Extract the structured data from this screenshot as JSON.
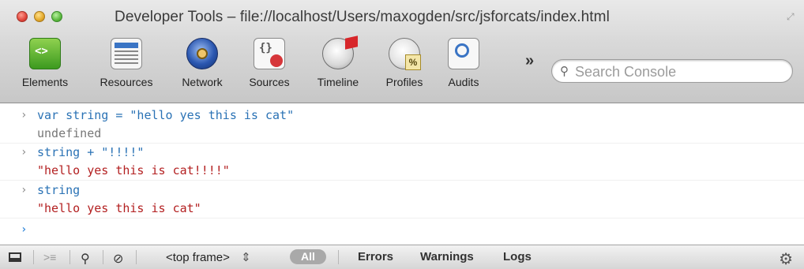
{
  "window": {
    "title": "Developer Tools – file://localhost/Users/maxogden/src/jsforcats/index.html"
  },
  "toolbar": {
    "tools": [
      {
        "label": "Elements",
        "icon": "elements-icon"
      },
      {
        "label": "Resources",
        "icon": "resources-icon"
      },
      {
        "label": "Network",
        "icon": "network-icon"
      },
      {
        "label": "Sources",
        "icon": "sources-icon"
      },
      {
        "label": "Timeline",
        "icon": "timeline-icon"
      },
      {
        "label": "Profiles",
        "icon": "profiles-icon"
      },
      {
        "label": "Audits",
        "icon": "audits-icon"
      }
    ],
    "more_label": "»",
    "search_placeholder": "Search Console"
  },
  "console": {
    "entries": [
      {
        "prompt": "›",
        "command": "var string = \"hello yes this is cat\"",
        "result": "undefined",
        "result_type": "undefined"
      },
      {
        "prompt": "›",
        "command": "string + \"!!!!\"",
        "result": "\"hello yes this is cat!!!!\"",
        "result_type": "string"
      },
      {
        "prompt": "›",
        "command": "string",
        "result": "\"hello yes this is cat\"",
        "result_type": "string"
      }
    ],
    "input_prompt": "›"
  },
  "statusbar": {
    "frame_select": "<top frame>",
    "frame_arrows": "⇕",
    "filters": [
      "All",
      "Errors",
      "Warnings",
      "Logs"
    ],
    "active_filter": "All"
  },
  "colors": {
    "command": "#2a72b5",
    "string_result": "#b32021",
    "undefined_result": "#777777",
    "prompt_active": "#3d8edc"
  }
}
